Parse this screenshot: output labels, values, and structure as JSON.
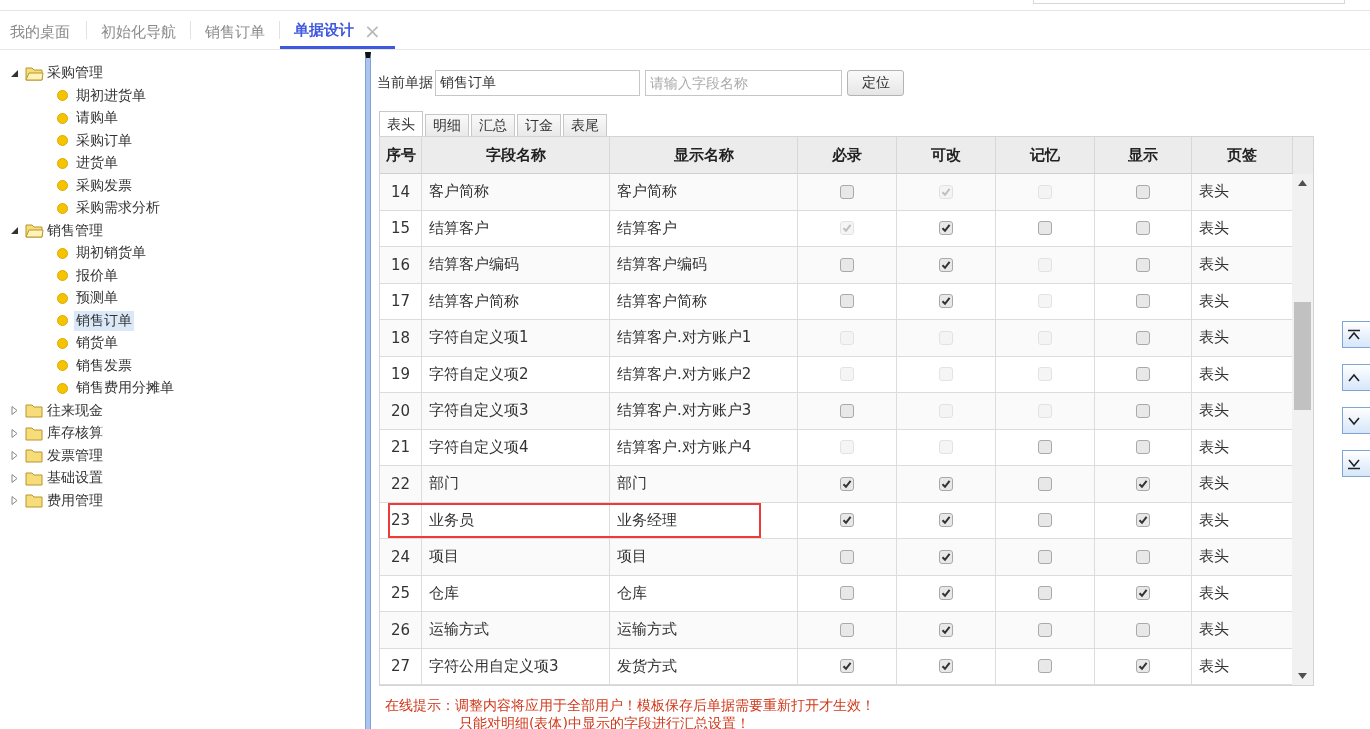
{
  "top_tabs": [
    {
      "label": "我的桌面",
      "selected": false
    },
    {
      "label": "初始化导航",
      "selected": false
    },
    {
      "label": "销售订单",
      "selected": false
    },
    {
      "label": "单据设计",
      "selected": true,
      "close": "×"
    }
  ],
  "sidebar": {
    "tree": [
      {
        "label": "采购管理",
        "expanded": true,
        "children": [
          {
            "label": "期初进货单",
            "selected": false
          },
          {
            "label": "请购单",
            "selected": false
          },
          {
            "label": "采购订单",
            "selected": false
          },
          {
            "label": "进货单",
            "selected": false
          },
          {
            "label": "采购发票",
            "selected": false
          },
          {
            "label": "采购需求分析",
            "selected": false
          }
        ]
      },
      {
        "label": "销售管理",
        "expanded": true,
        "children": [
          {
            "label": "期初销货单",
            "selected": false
          },
          {
            "label": "报价单",
            "selected": false
          },
          {
            "label": "预测单",
            "selected": false
          },
          {
            "label": "销售订单",
            "selected": true
          },
          {
            "label": "销货单",
            "selected": false
          },
          {
            "label": "销售发票",
            "selected": false
          },
          {
            "label": "销售费用分摊单",
            "selected": false
          }
        ]
      },
      {
        "label": "往来现金",
        "expanded": false
      },
      {
        "label": "库存核算",
        "expanded": false
      },
      {
        "label": "发票管理",
        "expanded": false
      },
      {
        "label": "基础设置",
        "expanded": false
      },
      {
        "label": "费用管理",
        "expanded": false
      }
    ]
  },
  "form": {
    "document_label": "当前单据",
    "document_value": "销售订单",
    "field_search": {
      "placeholder": "请输入字段名称"
    },
    "locate_button": "定位"
  },
  "section_tabs": [
    {
      "label": "表头",
      "selected": true
    },
    {
      "label": "明细",
      "selected": false
    },
    {
      "label": "汇总",
      "selected": false
    },
    {
      "label": "订金",
      "selected": false
    },
    {
      "label": "表尾",
      "selected": false
    }
  ],
  "table": {
    "columns": [
      "序号",
      "字段名称",
      "显示名称",
      "必录",
      "可改",
      "记忆",
      "显示",
      "页签"
    ],
    "rows": [
      {
        "no": "14",
        "field": "客户简称",
        "display": "客户简称",
        "flags": [
          {
            "checked": false,
            "disabled": false
          },
          {
            "checked": true,
            "disabled": true
          },
          {
            "checked": false,
            "disabled": true
          },
          {
            "checked": false,
            "disabled": false
          }
        ],
        "tab": "表头",
        "highlighted": false
      },
      {
        "no": "15",
        "field": "结算客户",
        "display": "结算客户",
        "flags": [
          {
            "checked": true,
            "disabled": true
          },
          {
            "checked": true,
            "disabled": false
          },
          {
            "checked": false,
            "disabled": false
          },
          {
            "checked": false,
            "disabled": false
          }
        ],
        "tab": "表头",
        "highlighted": false
      },
      {
        "no": "16",
        "field": "结算客户编码",
        "display": "结算客户编码",
        "flags": [
          {
            "checked": false,
            "disabled": false
          },
          {
            "checked": true,
            "disabled": false
          },
          {
            "checked": false,
            "disabled": true
          },
          {
            "checked": false,
            "disabled": false
          }
        ],
        "tab": "表头",
        "highlighted": false
      },
      {
        "no": "17",
        "field": "结算客户简称",
        "display": "结算客户简称",
        "flags": [
          {
            "checked": false,
            "disabled": false
          },
          {
            "checked": true,
            "disabled": false
          },
          {
            "checked": false,
            "disabled": true
          },
          {
            "checked": false,
            "disabled": false
          }
        ],
        "tab": "表头",
        "highlighted": false
      },
      {
        "no": "18",
        "field": "字符自定义项1",
        "display": "结算客户.对方账户1",
        "flags": [
          {
            "checked": false,
            "disabled": true
          },
          {
            "checked": false,
            "disabled": true
          },
          {
            "checked": false,
            "disabled": true
          },
          {
            "checked": false,
            "disabled": false
          }
        ],
        "tab": "表头",
        "highlighted": false
      },
      {
        "no": "19",
        "field": "字符自定义项2",
        "display": "结算客户.对方账户2",
        "flags": [
          {
            "checked": false,
            "disabled": true
          },
          {
            "checked": false,
            "disabled": true
          },
          {
            "checked": false,
            "disabled": true
          },
          {
            "checked": false,
            "disabled": false
          }
        ],
        "tab": "表头",
        "highlighted": false
      },
      {
        "no": "20",
        "field": "字符自定义项3",
        "display": "结算客户.对方账户3",
        "flags": [
          {
            "checked": false,
            "disabled": false
          },
          {
            "checked": false,
            "disabled": true
          },
          {
            "checked": false,
            "disabled": true
          },
          {
            "checked": false,
            "disabled": false
          }
        ],
        "tab": "表头",
        "highlighted": false
      },
      {
        "no": "21",
        "field": "字符自定义项4",
        "display": "结算客户.对方账户4",
        "flags": [
          {
            "checked": false,
            "disabled": true
          },
          {
            "checked": false,
            "disabled": true
          },
          {
            "checked": false,
            "disabled": false
          },
          {
            "checked": false,
            "disabled": false
          }
        ],
        "tab": "表头",
        "highlighted": false
      },
      {
        "no": "22",
        "field": "部门",
        "display": "部门",
        "flags": [
          {
            "checked": true,
            "disabled": false
          },
          {
            "checked": true,
            "disabled": false
          },
          {
            "checked": false,
            "disabled": false
          },
          {
            "checked": true,
            "disabled": false
          }
        ],
        "tab": "表头",
        "highlighted": false
      },
      {
        "no": "23",
        "field": "业务员",
        "display": "业务经理",
        "flags": [
          {
            "checked": true,
            "disabled": false
          },
          {
            "checked": true,
            "disabled": false
          },
          {
            "checked": false,
            "disabled": false
          },
          {
            "checked": true,
            "disabled": false
          }
        ],
        "tab": "表头",
        "highlighted": true
      },
      {
        "no": "24",
        "field": "项目",
        "display": "项目",
        "flags": [
          {
            "checked": false,
            "disabled": false
          },
          {
            "checked": true,
            "disabled": false
          },
          {
            "checked": false,
            "disabled": false
          },
          {
            "checked": false,
            "disabled": false
          }
        ],
        "tab": "表头",
        "highlighted": false
      },
      {
        "no": "25",
        "field": "仓库",
        "display": "仓库",
        "flags": [
          {
            "checked": false,
            "disabled": false
          },
          {
            "checked": true,
            "disabled": false
          },
          {
            "checked": false,
            "disabled": false
          },
          {
            "checked": true,
            "disabled": false
          }
        ],
        "tab": "表头",
        "highlighted": false
      },
      {
        "no": "26",
        "field": "运输方式",
        "display": "运输方式",
        "flags": [
          {
            "checked": false,
            "disabled": false
          },
          {
            "checked": true,
            "disabled": false
          },
          {
            "checked": false,
            "disabled": false
          },
          {
            "checked": false,
            "disabled": false
          }
        ],
        "tab": "表头",
        "highlighted": false
      },
      {
        "no": "27",
        "field": "字符公用自定义项3",
        "display": "发货方式",
        "flags": [
          {
            "checked": true,
            "disabled": false
          },
          {
            "checked": true,
            "disabled": false
          },
          {
            "checked": false,
            "disabled": false
          },
          {
            "checked": true,
            "disabled": false
          }
        ],
        "tab": "表头",
        "highlighted": false
      }
    ]
  },
  "notice": [
    "在线提示：调整内容将应用于全部用户！模板保存后单据需要重新打开才生效！",
    "只能对明细(表体)中显示的字段进行汇总设置！"
  ]
}
